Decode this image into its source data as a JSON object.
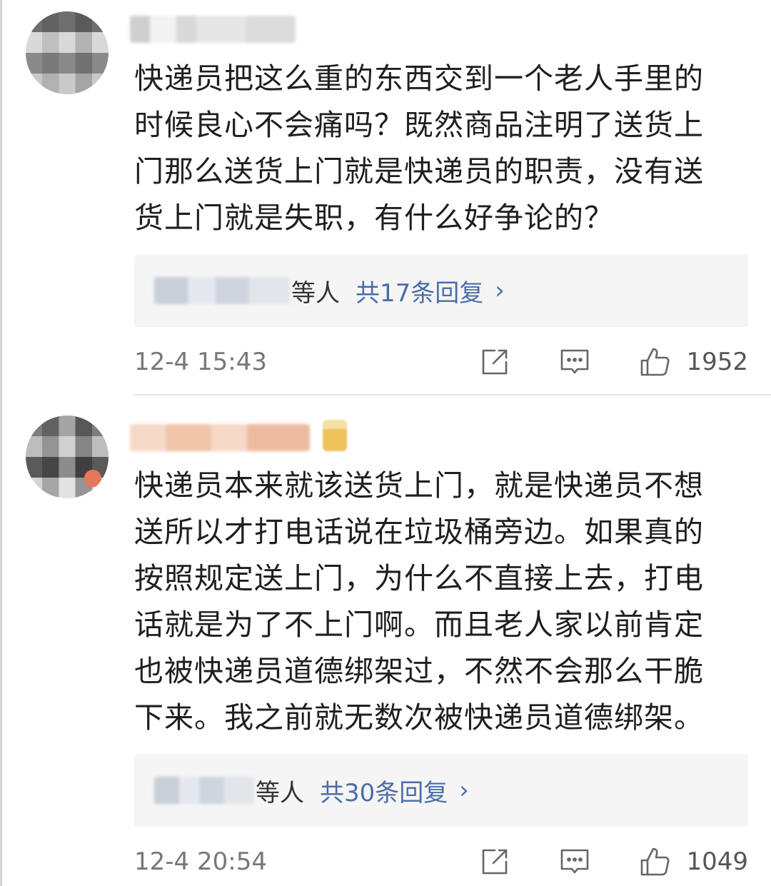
{
  "comments": [
    {
      "text": "快递员把这么重的东西交到一个老人手里的\n时候良心不会痛吗？既然商品注明了送货上\n门那么送货上门就是快递员的职责，没有送\n货上门就是失职，有什么好争论的？",
      "reply_suffix": "等人",
      "reply_count_label": "共17条回复",
      "timestamp": "12-4 15:43",
      "like_count": "1952"
    },
    {
      "text": "快递员本来就该送货上门，就是快递员不想\n送所以才打电话说在垃圾桶旁边。如果真的\n按照规定送上门，为什么不直接上去，打电\n话就是为了不上门啊。而且老人家以前肯定\n也被快递员道德绑架过，不然不会那么干脆\n下来。我之前就无数次被快递员道德绑架。",
      "reply_suffix": "等人",
      "reply_count_label": "共30条回复",
      "timestamp": "12-4 20:54",
      "like_count": "1049"
    }
  ],
  "icons": {
    "repost": "share-icon",
    "comment": "comment-icon",
    "like": "thumbs-up-icon",
    "chevron": "chevron-right-icon"
  },
  "colors": {
    "link": "#4a6ea8",
    "meta": "#777777",
    "reply_bg": "#f5f5f5"
  }
}
